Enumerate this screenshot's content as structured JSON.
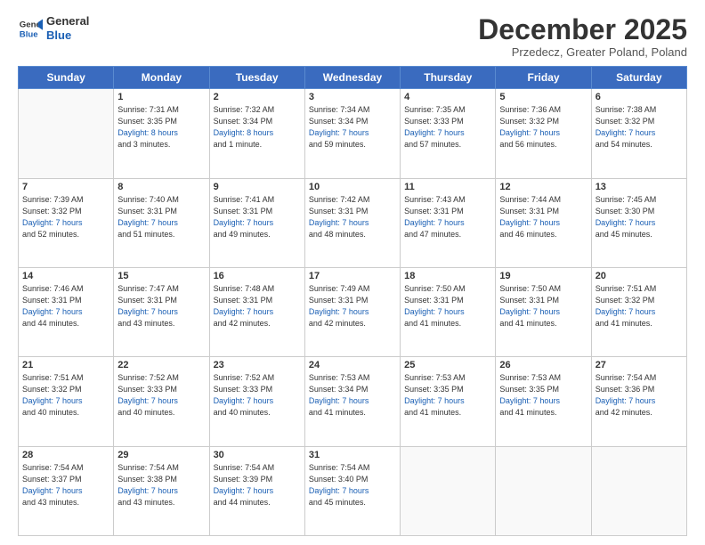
{
  "header": {
    "logo_line1": "General",
    "logo_line2": "Blue",
    "month": "December 2025",
    "location": "Przedecz, Greater Poland, Poland"
  },
  "weekdays": [
    "Sunday",
    "Monday",
    "Tuesday",
    "Wednesday",
    "Thursday",
    "Friday",
    "Saturday"
  ],
  "weeks": [
    [
      {
        "day": "",
        "info": ""
      },
      {
        "day": "1",
        "info": "Sunrise: 7:31 AM\nSunset: 3:35 PM\nDaylight: 8 hours\nand 3 minutes."
      },
      {
        "day": "2",
        "info": "Sunrise: 7:32 AM\nSunset: 3:34 PM\nDaylight: 8 hours\nand 1 minute."
      },
      {
        "day": "3",
        "info": "Sunrise: 7:34 AM\nSunset: 3:34 PM\nDaylight: 7 hours\nand 59 minutes."
      },
      {
        "day": "4",
        "info": "Sunrise: 7:35 AM\nSunset: 3:33 PM\nDaylight: 7 hours\nand 57 minutes."
      },
      {
        "day": "5",
        "info": "Sunrise: 7:36 AM\nSunset: 3:32 PM\nDaylight: 7 hours\nand 56 minutes."
      },
      {
        "day": "6",
        "info": "Sunrise: 7:38 AM\nSunset: 3:32 PM\nDaylight: 7 hours\nand 54 minutes."
      }
    ],
    [
      {
        "day": "7",
        "info": "Sunrise: 7:39 AM\nSunset: 3:32 PM\nDaylight: 7 hours\nand 52 minutes."
      },
      {
        "day": "8",
        "info": "Sunrise: 7:40 AM\nSunset: 3:31 PM\nDaylight: 7 hours\nand 51 minutes."
      },
      {
        "day": "9",
        "info": "Sunrise: 7:41 AM\nSunset: 3:31 PM\nDaylight: 7 hours\nand 49 minutes."
      },
      {
        "day": "10",
        "info": "Sunrise: 7:42 AM\nSunset: 3:31 PM\nDaylight: 7 hours\nand 48 minutes."
      },
      {
        "day": "11",
        "info": "Sunrise: 7:43 AM\nSunset: 3:31 PM\nDaylight: 7 hours\nand 47 minutes."
      },
      {
        "day": "12",
        "info": "Sunrise: 7:44 AM\nSunset: 3:31 PM\nDaylight: 7 hours\nand 46 minutes."
      },
      {
        "day": "13",
        "info": "Sunrise: 7:45 AM\nSunset: 3:30 PM\nDaylight: 7 hours\nand 45 minutes."
      }
    ],
    [
      {
        "day": "14",
        "info": "Sunrise: 7:46 AM\nSunset: 3:31 PM\nDaylight: 7 hours\nand 44 minutes."
      },
      {
        "day": "15",
        "info": "Sunrise: 7:47 AM\nSunset: 3:31 PM\nDaylight: 7 hours\nand 43 minutes."
      },
      {
        "day": "16",
        "info": "Sunrise: 7:48 AM\nSunset: 3:31 PM\nDaylight: 7 hours\nand 42 minutes."
      },
      {
        "day": "17",
        "info": "Sunrise: 7:49 AM\nSunset: 3:31 PM\nDaylight: 7 hours\nand 42 minutes."
      },
      {
        "day": "18",
        "info": "Sunrise: 7:50 AM\nSunset: 3:31 PM\nDaylight: 7 hours\nand 41 minutes."
      },
      {
        "day": "19",
        "info": "Sunrise: 7:50 AM\nSunset: 3:31 PM\nDaylight: 7 hours\nand 41 minutes."
      },
      {
        "day": "20",
        "info": "Sunrise: 7:51 AM\nSunset: 3:32 PM\nDaylight: 7 hours\nand 41 minutes."
      }
    ],
    [
      {
        "day": "21",
        "info": "Sunrise: 7:51 AM\nSunset: 3:32 PM\nDaylight: 7 hours\nand 40 minutes."
      },
      {
        "day": "22",
        "info": "Sunrise: 7:52 AM\nSunset: 3:33 PM\nDaylight: 7 hours\nand 40 minutes."
      },
      {
        "day": "23",
        "info": "Sunrise: 7:52 AM\nSunset: 3:33 PM\nDaylight: 7 hours\nand 40 minutes."
      },
      {
        "day": "24",
        "info": "Sunrise: 7:53 AM\nSunset: 3:34 PM\nDaylight: 7 hours\nand 41 minutes."
      },
      {
        "day": "25",
        "info": "Sunrise: 7:53 AM\nSunset: 3:35 PM\nDaylight: 7 hours\nand 41 minutes."
      },
      {
        "day": "26",
        "info": "Sunrise: 7:53 AM\nSunset: 3:35 PM\nDaylight: 7 hours\nand 41 minutes."
      },
      {
        "day": "27",
        "info": "Sunrise: 7:54 AM\nSunset: 3:36 PM\nDaylight: 7 hours\nand 42 minutes."
      }
    ],
    [
      {
        "day": "28",
        "info": "Sunrise: 7:54 AM\nSunset: 3:37 PM\nDaylight: 7 hours\nand 43 minutes."
      },
      {
        "day": "29",
        "info": "Sunrise: 7:54 AM\nSunset: 3:38 PM\nDaylight: 7 hours\nand 43 minutes."
      },
      {
        "day": "30",
        "info": "Sunrise: 7:54 AM\nSunset: 3:39 PM\nDaylight: 7 hours\nand 44 minutes."
      },
      {
        "day": "31",
        "info": "Sunrise: 7:54 AM\nSunset: 3:40 PM\nDaylight: 7 hours\nand 45 minutes."
      },
      {
        "day": "",
        "info": ""
      },
      {
        "day": "",
        "info": ""
      },
      {
        "day": "",
        "info": ""
      }
    ]
  ]
}
